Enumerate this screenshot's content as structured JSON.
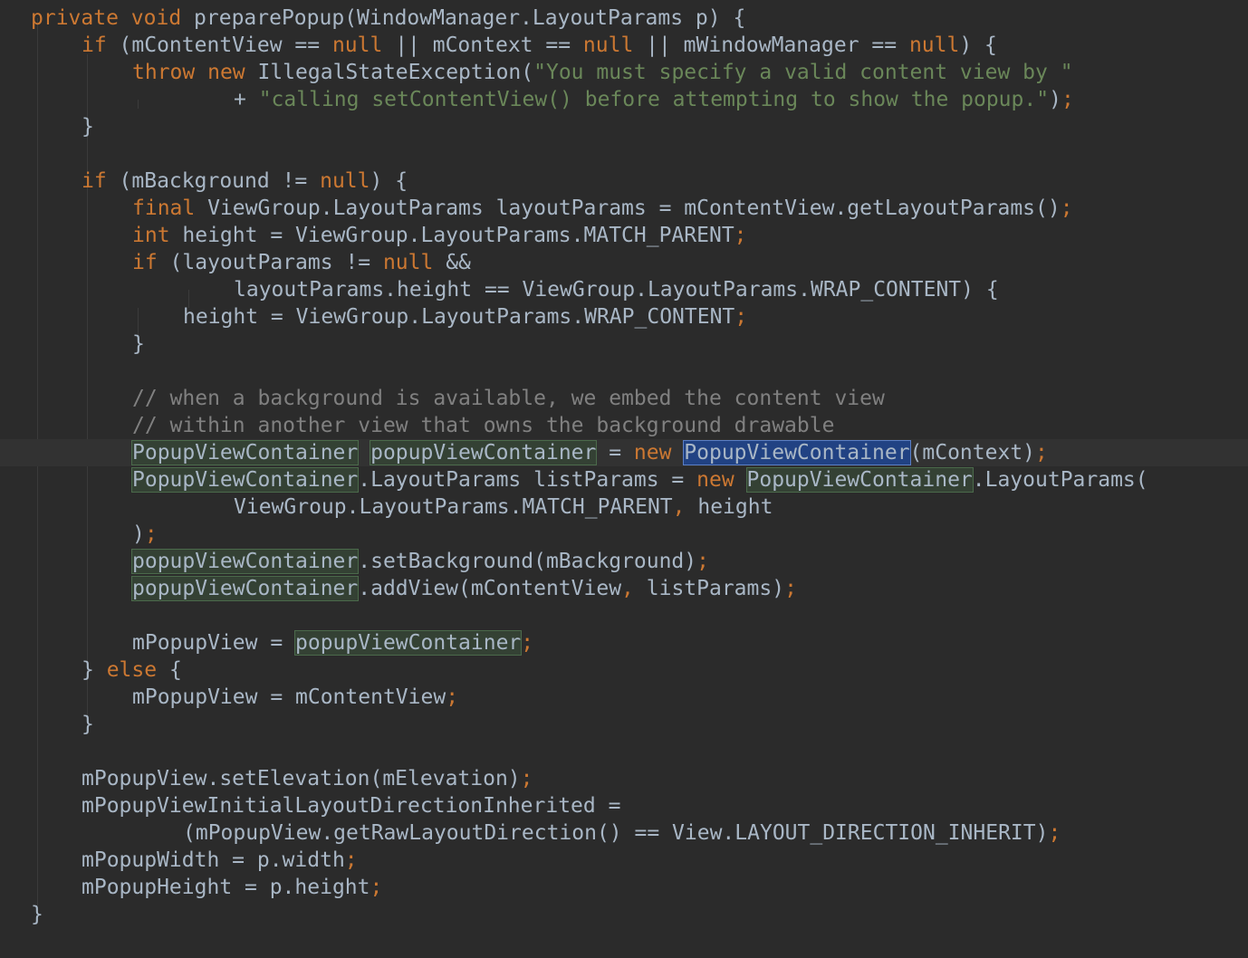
{
  "editor": {
    "language": "Java",
    "theme": "Darcula",
    "current_line": 17,
    "colors": {
      "background": "#2b2b2b",
      "keyword": "#cc7832",
      "string": "#6a8759",
      "comment": "#808080",
      "text": "#a9b7c6",
      "usage_highlight": "#344134",
      "caret_identifier_highlight": "#214283"
    },
    "lines": [
      {
        "indent": 2,
        "tokens": [
          {
            "t": "private ",
            "c": "kw"
          },
          {
            "t": "void ",
            "c": "kw"
          },
          {
            "t": "preparePopup(WindowManager.LayoutParams p) {",
            "c": "pl"
          }
        ]
      },
      {
        "indent": 6,
        "tokens": [
          {
            "t": "if ",
            "c": "kw"
          },
          {
            "t": "(mContentView == ",
            "c": "pl"
          },
          {
            "t": "null",
            "c": "kw"
          },
          {
            "t": " || mContext == ",
            "c": "pl"
          },
          {
            "t": "null",
            "c": "kw"
          },
          {
            "t": " || mWindowManager == ",
            "c": "pl"
          },
          {
            "t": "null",
            "c": "kw"
          },
          {
            "t": ") {",
            "c": "pl"
          }
        ]
      },
      {
        "indent": 10,
        "tokens": [
          {
            "t": "throw ",
            "c": "kw"
          },
          {
            "t": "new ",
            "c": "kw"
          },
          {
            "t": "IllegalStateException(",
            "c": "pl"
          },
          {
            "t": "\"You must specify a valid content view by \"",
            "c": "str"
          }
        ]
      },
      {
        "indent": 18,
        "tokens": [
          {
            "t": "+ ",
            "c": "pl"
          },
          {
            "t": "\"calling setContentView() before attempting to show the popup.\"",
            "c": "str"
          },
          {
            "t": ")",
            "c": "pl"
          },
          {
            "t": ";",
            "c": "kw"
          }
        ]
      },
      {
        "indent": 6,
        "tokens": [
          {
            "t": "}",
            "c": "pl"
          }
        ]
      },
      {
        "indent": 0,
        "tokens": []
      },
      {
        "indent": 6,
        "tokens": [
          {
            "t": "if ",
            "c": "kw"
          },
          {
            "t": "(mBackground != ",
            "c": "pl"
          },
          {
            "t": "null",
            "c": "kw"
          },
          {
            "t": ") {",
            "c": "pl"
          }
        ]
      },
      {
        "indent": 10,
        "tokens": [
          {
            "t": "final ",
            "c": "kw"
          },
          {
            "t": "ViewGroup.LayoutParams layoutParams = mContentView.getLayoutParams()",
            "c": "pl"
          },
          {
            "t": ";",
            "c": "kw"
          }
        ]
      },
      {
        "indent": 10,
        "tokens": [
          {
            "t": "int ",
            "c": "kw"
          },
          {
            "t": "height = ViewGroup.LayoutParams.MATCH_PARENT",
            "c": "pl"
          },
          {
            "t": ";",
            "c": "kw"
          }
        ]
      },
      {
        "indent": 10,
        "tokens": [
          {
            "t": "if ",
            "c": "kw"
          },
          {
            "t": "(layoutParams != ",
            "c": "pl"
          },
          {
            "t": "null ",
            "c": "kw"
          },
          {
            "t": "&&",
            "c": "pl"
          }
        ]
      },
      {
        "indent": 18,
        "tokens": [
          {
            "t": "layoutParams.height == ViewGroup.LayoutParams.WRAP_CONTENT) {",
            "c": "pl"
          }
        ]
      },
      {
        "indent": 14,
        "tokens": [
          {
            "t": "height = ViewGroup.LayoutParams.WRAP_CONTENT",
            "c": "pl"
          },
          {
            "t": ";",
            "c": "kw"
          }
        ]
      },
      {
        "indent": 10,
        "tokens": [
          {
            "t": "}",
            "c": "pl"
          }
        ]
      },
      {
        "indent": 0,
        "tokens": []
      },
      {
        "indent": 10,
        "tokens": [
          {
            "t": "// when a background is available, we embed the content view",
            "c": "cmt"
          }
        ]
      },
      {
        "indent": 10,
        "tokens": [
          {
            "t": "// within another view that owns the background drawable",
            "c": "cmt"
          }
        ]
      },
      {
        "indent": 10,
        "tokens": [
          {
            "t": "PopupViewContainer",
            "c": "pl",
            "hl": "usage"
          },
          {
            "t": " ",
            "c": "pl"
          },
          {
            "t": "popupViewContainer",
            "c": "pl",
            "hl": "usage"
          },
          {
            "t": " = ",
            "c": "pl"
          },
          {
            "t": "new ",
            "c": "kw"
          },
          {
            "t": "PopupViewContainer",
            "c": "pl",
            "hl": "caret"
          },
          {
            "t": "(mContext)",
            "c": "pl"
          },
          {
            "t": ";",
            "c": "kw"
          }
        ]
      },
      {
        "indent": 10,
        "tokens": [
          {
            "t": "PopupViewContainer",
            "c": "pl",
            "hl": "usage"
          },
          {
            "t": ".LayoutParams listParams = ",
            "c": "pl"
          },
          {
            "t": "new ",
            "c": "kw"
          },
          {
            "t": "PopupViewContainer",
            "c": "pl",
            "hl": "usage"
          },
          {
            "t": ".LayoutParams(",
            "c": "pl"
          }
        ]
      },
      {
        "indent": 18,
        "tokens": [
          {
            "t": "ViewGroup.LayoutParams.MATCH_PARENT",
            "c": "pl"
          },
          {
            "t": ", ",
            "c": "kw"
          },
          {
            "t": "height",
            "c": "pl"
          }
        ]
      },
      {
        "indent": 10,
        "tokens": [
          {
            "t": ")",
            "c": "pl"
          },
          {
            "t": ";",
            "c": "kw"
          }
        ]
      },
      {
        "indent": 10,
        "tokens": [
          {
            "t": "popupViewContainer",
            "c": "pl",
            "hl": "usage"
          },
          {
            "t": ".setBackground(mBackground)",
            "c": "pl"
          },
          {
            "t": ";",
            "c": "kw"
          }
        ]
      },
      {
        "indent": 10,
        "tokens": [
          {
            "t": "popupViewContainer",
            "c": "pl",
            "hl": "usage"
          },
          {
            "t": ".addView(mContentView",
            "c": "pl"
          },
          {
            "t": ", ",
            "c": "kw"
          },
          {
            "t": "listParams)",
            "c": "pl"
          },
          {
            "t": ";",
            "c": "kw"
          }
        ]
      },
      {
        "indent": 0,
        "tokens": []
      },
      {
        "indent": 10,
        "tokens": [
          {
            "t": "mPopupView = ",
            "c": "pl"
          },
          {
            "t": "popupViewContainer",
            "c": "pl",
            "hl": "usage"
          },
          {
            "t": ";",
            "c": "kw"
          }
        ]
      },
      {
        "indent": 6,
        "tokens": [
          {
            "t": "} ",
            "c": "pl"
          },
          {
            "t": "else ",
            "c": "kw"
          },
          {
            "t": "{",
            "c": "pl"
          }
        ]
      },
      {
        "indent": 10,
        "tokens": [
          {
            "t": "mPopupView = mContentView",
            "c": "pl"
          },
          {
            "t": ";",
            "c": "kw"
          }
        ]
      },
      {
        "indent": 6,
        "tokens": [
          {
            "t": "}",
            "c": "pl"
          }
        ]
      },
      {
        "indent": 0,
        "tokens": []
      },
      {
        "indent": 6,
        "tokens": [
          {
            "t": "mPopupView.setElevation(mElevation)",
            "c": "pl"
          },
          {
            "t": ";",
            "c": "kw"
          }
        ]
      },
      {
        "indent": 6,
        "tokens": [
          {
            "t": "mPopupViewInitialLayoutDirectionInherited =",
            "c": "pl"
          }
        ]
      },
      {
        "indent": 14,
        "tokens": [
          {
            "t": "(mPopupView.getRawLayoutDirection() == View.LAYOUT_DIRECTION_INHERIT)",
            "c": "pl"
          },
          {
            "t": ";",
            "c": "kw"
          }
        ]
      },
      {
        "indent": 6,
        "tokens": [
          {
            "t": "mPopupWidth = p.width",
            "c": "pl"
          },
          {
            "t": ";",
            "c": "kw"
          }
        ]
      },
      {
        "indent": 6,
        "tokens": [
          {
            "t": "mPopupHeight = p.height",
            "c": "pl"
          },
          {
            "t": ";",
            "c": "kw"
          }
        ]
      },
      {
        "indent": 2,
        "tokens": [
          {
            "t": "}",
            "c": "pl"
          }
        ]
      }
    ]
  }
}
